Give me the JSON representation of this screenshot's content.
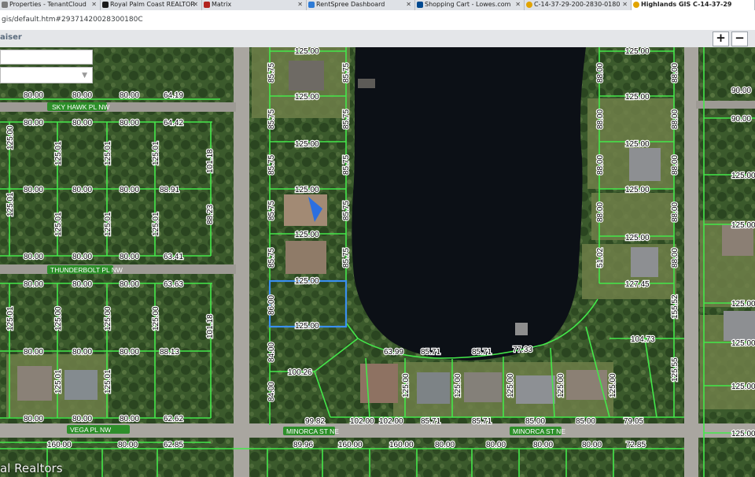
{
  "browser": {
    "tabs": [
      {
        "label": "Properties - TenantCloud",
        "active": false,
        "color": "#7b7b7b"
      },
      {
        "label": "Royal Palm Coast REALTOR",
        "active": false,
        "color": "#1a1a1a"
      },
      {
        "label": "Matrix",
        "active": false,
        "color": "#b2241f"
      },
      {
        "label": "RentSpree Dashboard",
        "active": false,
        "color": "#2e7bd6"
      },
      {
        "label": "Shopping Cart - Lowes.com",
        "active": false,
        "color": "#004990"
      },
      {
        "label": "C-14-37-29-200-2830-0180",
        "active": false,
        "color": "#e2a400"
      },
      {
        "label": "Highlands GIS C-14-37-29",
        "active": true,
        "color": "#e2a400"
      }
    ],
    "address": "gis/default.htm#29371420028300180C"
  },
  "app": {
    "title": "aiser",
    "zoom_in": "+",
    "zoom_out": "−"
  },
  "streets": {
    "sky_hawk": "SKY HAWK PL NW",
    "thunderbolt": "THUNDERBOLT PL NW",
    "vega": "VEGA PL NW",
    "minorca_1": "MINORCA ST NE",
    "minorca_2": "MINORCA ST NE"
  },
  "watermark": "al Realtors",
  "colors": {
    "parcel_line": "#44e84a",
    "selection": "#3a8ff0",
    "street_label_bg": "#2d8f2a"
  }
}
